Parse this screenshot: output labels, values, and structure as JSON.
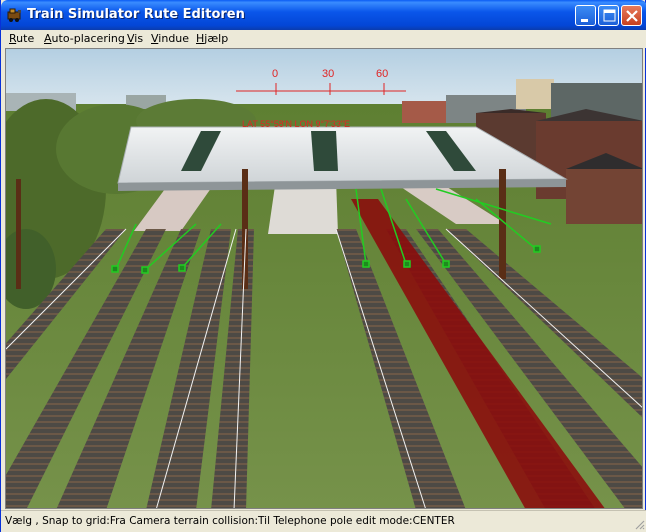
{
  "window": {
    "title": "Train Simulator Rute Editoren"
  },
  "menu": {
    "items": [
      {
        "label_first": "R",
        "label_rest": "ute"
      },
      {
        "label_first": "A",
        "label_rest": "uto-placering"
      },
      {
        "label_first": "V",
        "label_rest": "is"
      },
      {
        "label_first": "V",
        "label_rest": "indue"
      },
      {
        "label_first": "H",
        "label_rest": "jælp"
      }
    ]
  },
  "viewport": {
    "compass_ticks": [
      "0",
      "30",
      "60"
    ],
    "overlay_text": "LAT 55°58'N LON 9°7'33\"E",
    "colors": {
      "sky": "#c4d9e6",
      "grass": "#6a8a3e",
      "selected_track": "#8b0000",
      "platform_roof": "#e6e9eb",
      "track_marker": "#22cc22"
    }
  },
  "status": {
    "text": "Vælg , Snap to grid:Fra Camera terrain collision:Til Telephone pole edit mode:CENTER"
  },
  "icons": {
    "app": "train-app-icon",
    "minimize": "minimize-icon",
    "maximize": "maximize-icon",
    "close": "close-icon"
  }
}
